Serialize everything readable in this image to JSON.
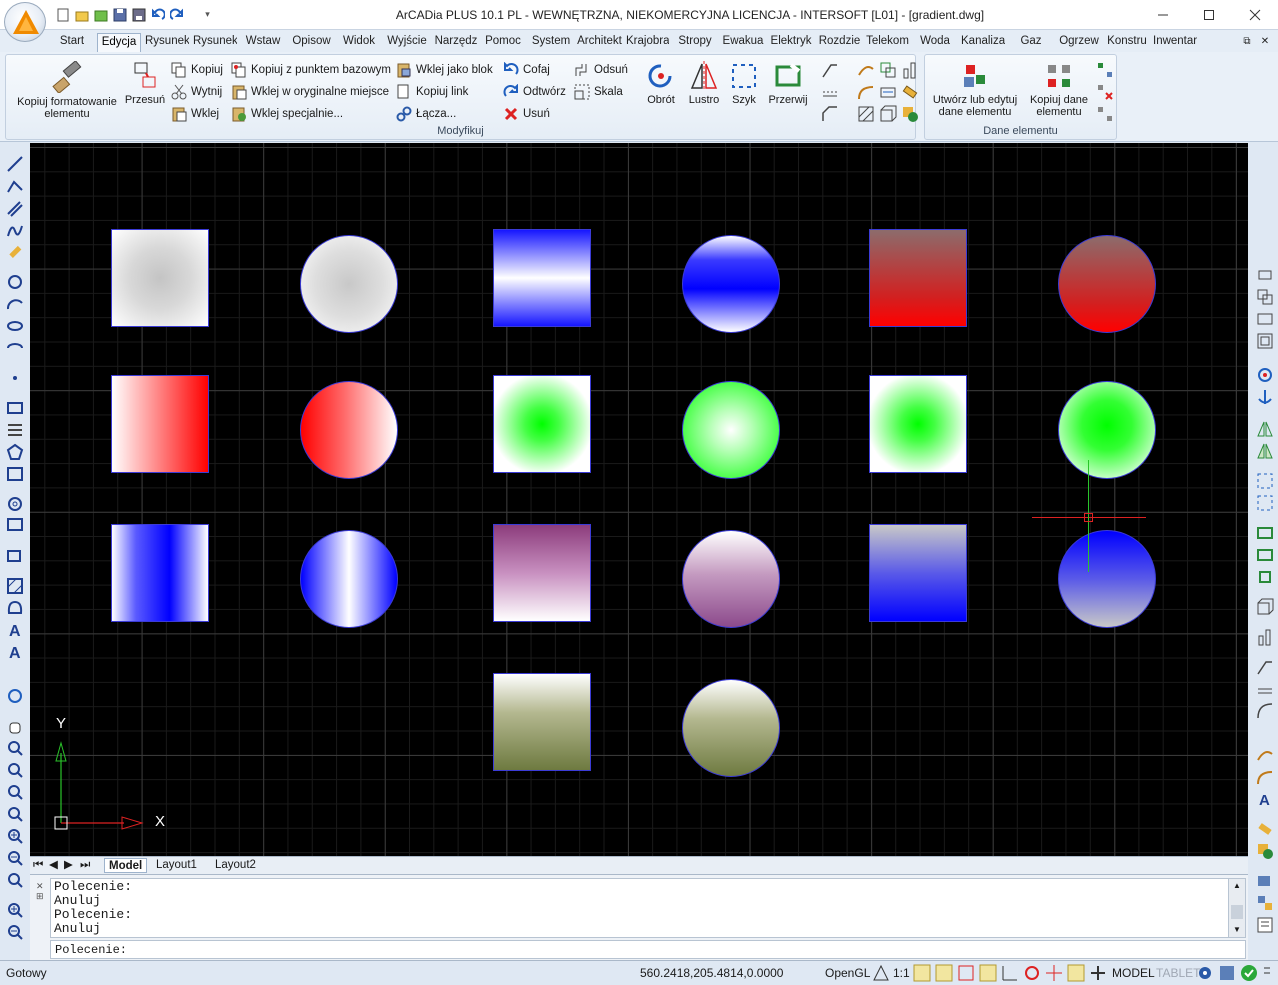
{
  "app": {
    "title": "ArCADia PLUS 10.1 PL - WEWNĘTRZNA, NIEKOMERCYJNA LICENCJA - INTERSOFT [L01] - [gradient.dwg]"
  },
  "tabs": [
    "Start",
    "Edycja",
    "Rysunek",
    "Rysunek",
    "Wstaw",
    "Opisow",
    "Widok",
    "Wyjście",
    "Narzędz",
    "Pomoc",
    "System",
    "Architekt",
    "Krajobraz",
    "Stropy",
    "Ewakua",
    "Elektryk",
    "Rozdzie",
    "Telekom",
    "Woda",
    "Kanalizacja",
    "Gaz",
    "Ogrzew",
    "Konstru",
    "Inwentar"
  ],
  "ribbon": {
    "modify_group": "Modyfikuj",
    "element_group": "Dane elementu",
    "copy_format": "Kopiuj formatowanie elementu",
    "move": "Przesuń",
    "copy": "Kopiuj",
    "cut": "Wytnij",
    "paste": "Wklej",
    "copy_base": "Kopiuj z punktem bazowym",
    "paste_original": "Wklej w oryginalne miejsce",
    "paste_special": "Wklej specjalnie...",
    "paste_block": "Wklej jako blok",
    "copy_link": "Kopiuj link",
    "links": "Łącza...",
    "undo": "Cofaj",
    "redo": "Odtwórz",
    "delete": "Usuń",
    "refresh": "Odsuń",
    "scale": "Skala",
    "rotate": "Obrót",
    "mirror": "Lustro",
    "array": "Szyk",
    "crop": "Przerwij",
    "create_edit": "Utwórz lub edytuj dane elementu",
    "copy_data": "Kopiuj dane elementu"
  },
  "canvas": {
    "ucs_x": "X",
    "ucs_y": "Y"
  },
  "layout_tabs": [
    "Model",
    "Layout1",
    "Layout2"
  ],
  "command": {
    "log": [
      "Polecenie:",
      "Anuluj",
      "Polecenie:",
      "Anuluj"
    ],
    "prompt": "Polecenie:"
  },
  "status": {
    "ready": "Gotowy",
    "coords": "560.2418,205.4814,0.0000",
    "renderer": "OpenGL",
    "scale": "1:1",
    "model": "MODEL",
    "tablet": "TABLET"
  }
}
